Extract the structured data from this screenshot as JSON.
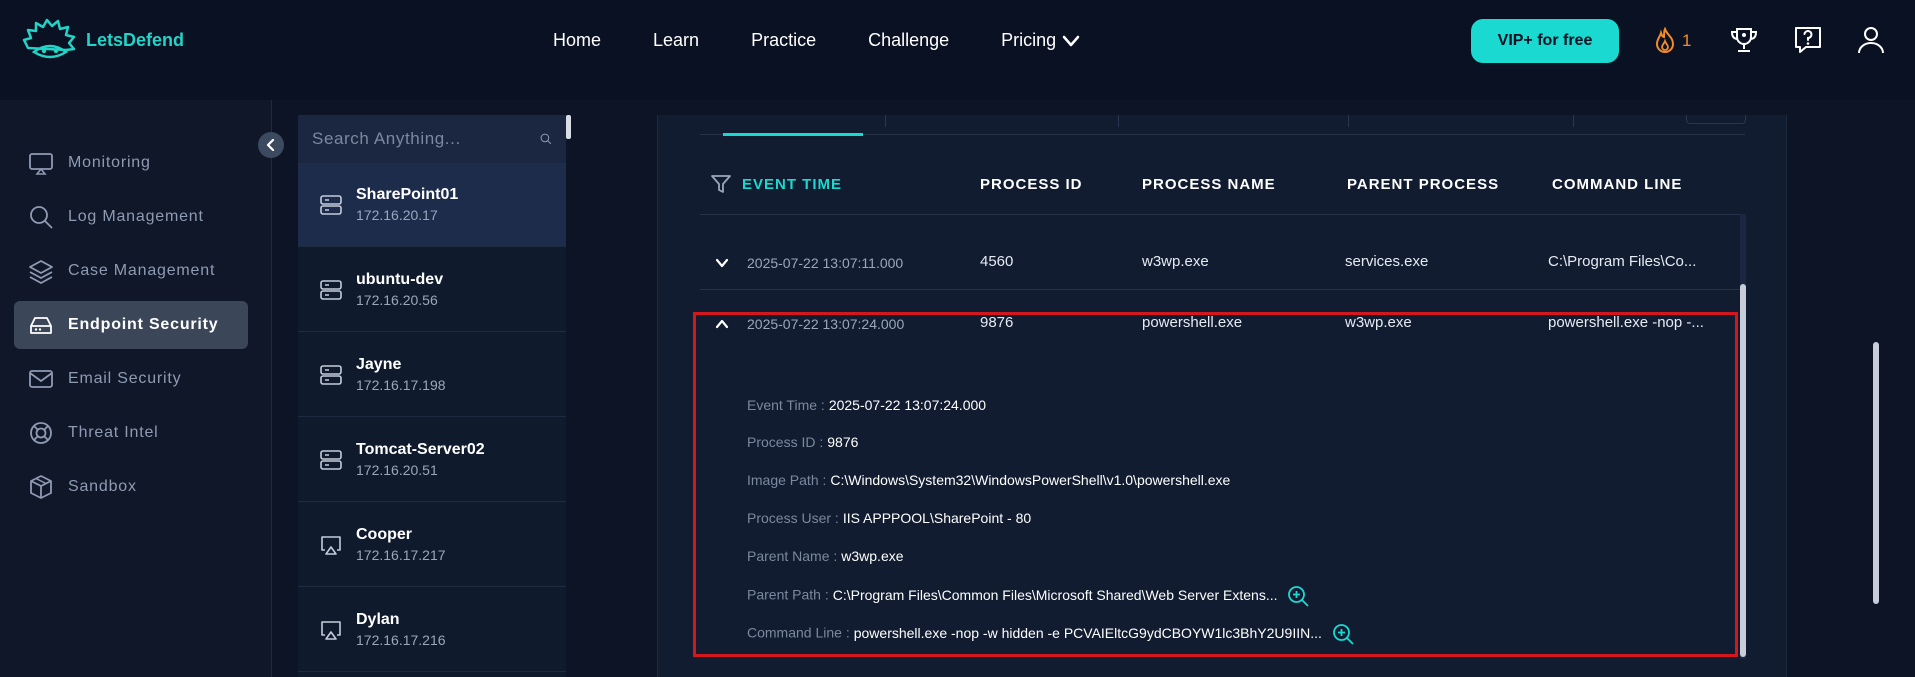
{
  "brand": {
    "name": "LetsDefend"
  },
  "nav": {
    "items": [
      "Home",
      "Learn",
      "Practice",
      "Challenge",
      "Pricing"
    ]
  },
  "header": {
    "vip_label": "VIP+ for free",
    "streak_count": "1"
  },
  "sidebar": {
    "items": [
      {
        "label": "Monitoring",
        "icon": "monitor-icon"
      },
      {
        "label": "Log Management",
        "icon": "search-icon"
      },
      {
        "label": "Case Management",
        "icon": "layers-icon"
      },
      {
        "label": "Endpoint Security",
        "icon": "drive-icon",
        "active": true
      },
      {
        "label": "Email Security",
        "icon": "mail-icon"
      },
      {
        "label": "Threat Intel",
        "icon": "lifebuoy-icon"
      },
      {
        "label": "Sandbox",
        "icon": "cube-icon"
      }
    ]
  },
  "hosts": {
    "search_placeholder": "Search Anything...",
    "items": [
      {
        "name": "SharePoint01",
        "ip": "172.16.20.17",
        "icon": "server-icon",
        "active": true
      },
      {
        "name": "ubuntu-dev",
        "ip": "172.16.20.56",
        "icon": "server-icon"
      },
      {
        "name": "Jayne",
        "ip": "172.16.17.198",
        "icon": "server-icon"
      },
      {
        "name": "Tomcat-Server02",
        "ip": "172.16.20.51",
        "icon": "server-icon"
      },
      {
        "name": "Cooper",
        "ip": "172.16.17.217",
        "icon": "airplay-icon"
      },
      {
        "name": "Dylan",
        "ip": "172.16.17.216",
        "icon": "airplay-icon"
      }
    ]
  },
  "table": {
    "headers": [
      "EVENT TIME",
      "PROCESS ID",
      "PROCESS NAME",
      "PARENT PROCESS",
      "COMMAND LINE"
    ],
    "rows": [
      {
        "time": "2025-07-22 13:07:11.000",
        "pid": "4560",
        "name": "w3wp.exe",
        "parent": "services.exe",
        "cmd": "C:\\Program Files\\Co..."
      },
      {
        "time": "2025-07-22 13:07:24.000",
        "pid": "9876",
        "name": "powershell.exe",
        "parent": "w3wp.exe",
        "cmd": "powershell.exe -nop -..."
      }
    ],
    "details": [
      {
        "key": "Event Time :",
        "value": "2025-07-22 13:07:24.000"
      },
      {
        "key": "Process ID :",
        "value": "9876"
      },
      {
        "key": "Image Path :",
        "value": "C:\\Windows\\System32\\WindowsPowerShell\\v1.0\\powershell.exe"
      },
      {
        "key": "Process User :",
        "value": "IIS APPPOOL\\SharePoint - 80"
      },
      {
        "key": "Parent Name :",
        "value": "w3wp.exe"
      },
      {
        "key": "Parent Path :",
        "value": "C:\\Program Files\\Common Files\\Microsoft Shared\\Web Server Extens..."
      },
      {
        "key": "Command Line :",
        "value": "powershell.exe -nop -w hidden -e PCVAIEltcG9ydCBOYW1lc3BhY2U9IIN..."
      }
    ]
  },
  "colors": {
    "accent": "#19d9d0",
    "highlight": "#d4161f",
    "streak": "#f58a2a"
  }
}
